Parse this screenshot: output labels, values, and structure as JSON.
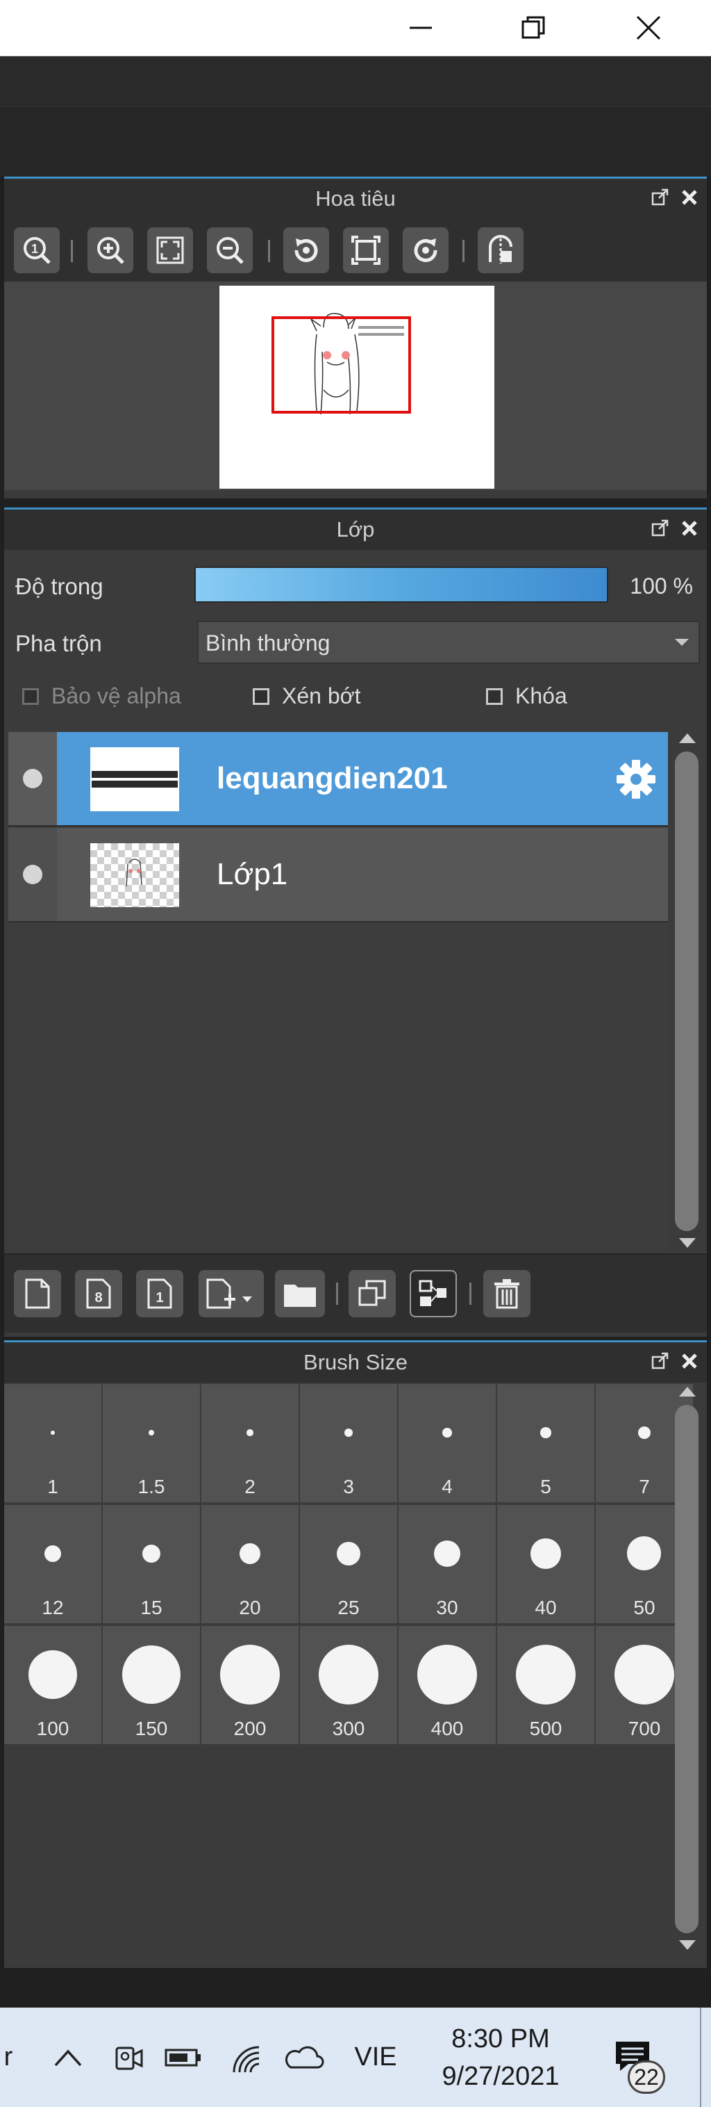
{
  "window": {
    "minimize_icon": "minimize-icon",
    "restore_icon": "restore-icon",
    "close_icon": "close-icon"
  },
  "navigator": {
    "title": "Hoa tiêu",
    "tools": [
      "zoom-actual-icon",
      "zoom-in-icon",
      "fit-icon",
      "zoom-out-icon",
      "rotate-left-icon",
      "fit-rotate-icon",
      "rotate-right-icon",
      "flip-icon"
    ]
  },
  "layers": {
    "title": "Lớp",
    "opacity_label": "Độ trong",
    "opacity_value": "100 %",
    "opacity_fraction": 1.0,
    "blend_label": "Pha trộn",
    "blend_value": "Bình thường",
    "checkboxes": [
      {
        "label": "Bảo vệ alpha",
        "checked": false,
        "disabled": true
      },
      {
        "label": "Xén bớt",
        "checked": false,
        "disabled": false
      },
      {
        "label": "Khóa",
        "checked": false,
        "disabled": false
      }
    ],
    "items": [
      {
        "name": "lequangdien201",
        "selected": true
      },
      {
        "name": "Lớp1",
        "selected": false
      }
    ],
    "toolbar": [
      "new-layer-icon",
      "new-8bit-layer-icon",
      "new-1bit-layer-icon",
      "add-layer-dropdown-icon",
      "folder-icon",
      "duplicate-icon",
      "merge-icon",
      "trash-icon"
    ]
  },
  "brush_size": {
    "title": "Brush Size",
    "sizes": [
      "1",
      "1.5",
      "2",
      "3",
      "4",
      "5",
      "7",
      "12",
      "15",
      "20",
      "25",
      "30",
      "40",
      "50",
      "100",
      "150",
      "200",
      "300",
      "400",
      "500",
      "700"
    ]
  },
  "taskbar": {
    "partial_label": "r",
    "language": "VIE",
    "time": "8:30 PM",
    "date": "9/27/2021",
    "notifications": "22"
  }
}
